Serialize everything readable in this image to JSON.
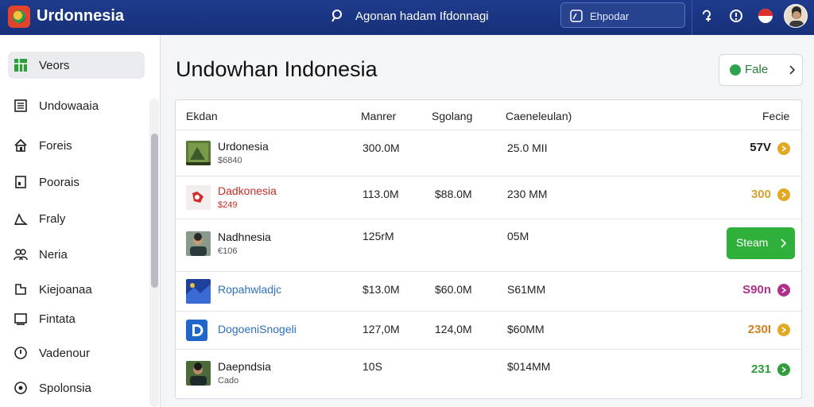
{
  "header": {
    "app_title": "Urdonnesia",
    "center_text": "Agonan hadam Ifdonnagi",
    "search_placeholder": "Ehpodar"
  },
  "sidebar": {
    "items": [
      {
        "label": "Veors",
        "icon": "grid-icon",
        "active": true
      },
      {
        "label": "Undowaaia",
        "icon": "document-icon",
        "active": false
      },
      {
        "label": "Foreis",
        "icon": "home-icon",
        "active": false
      },
      {
        "label": "Poorais",
        "icon": "page-icon",
        "active": false
      },
      {
        "label": "Fraly",
        "icon": "chart-icon",
        "active": false
      },
      {
        "label": "Neria",
        "icon": "people-icon",
        "active": false
      },
      {
        "label": "Kiejoanaa",
        "icon": "book-icon",
        "active": false
      },
      {
        "label": "Fintata",
        "icon": "folder-icon",
        "active": false
      },
      {
        "label": "Vadenour",
        "icon": "clock-icon",
        "active": false
      },
      {
        "label": "Spolonsia",
        "icon": "settings-icon",
        "active": false
      }
    ]
  },
  "main": {
    "title": "Undowhan Indonesia",
    "file_button_label": "Fale"
  },
  "table": {
    "columns": [
      "Ekdan",
      "Manrer",
      "Sgolang",
      "Caeneleulan)",
      "Fecie"
    ],
    "rows": [
      {
        "name": "Urdonesia",
        "sub": "$6840",
        "c1": "300.0M",
        "c2": "",
        "c3": "25.0 MII",
        "value": "57V",
        "name_color": "#1a1a1a",
        "value_color": "#1a1a1a",
        "dot_color": "#e3a923"
      },
      {
        "name": "Dadkonesia",
        "sub": "$249",
        "c1": "113.0M",
        "c2": "$88.0M",
        "c3": "230 MM",
        "value": "300",
        "name_color": "#c62d25",
        "value_color": "#d4a32a",
        "dot_color": "#e3a923"
      },
      {
        "name": "Nadhnesia",
        "sub": "€106",
        "c1": "125rM",
        "c2": "",
        "c3": "05M",
        "value": "",
        "button_label": "Steam",
        "name_color": "#1a1a1a",
        "value_color": "#1a1a1a",
        "dot_color": ""
      },
      {
        "name": "Ropahwladjc",
        "sub": "",
        "c1": "$13.0M",
        "c2": "$60.0M",
        "c3": "S61MM",
        "value": "S90n",
        "name_color": "#2a6fc0",
        "value_color": "#b0308e",
        "dot_color": "#b0308e"
      },
      {
        "name": "DogoeniSnogeli",
        "sub": "",
        "c1": "127,0M",
        "c2": "124,0M",
        "c3": "$60MM",
        "value": "230I",
        "name_color": "#2a6fc0",
        "value_color": "#d0821f",
        "dot_color": "#e3a923"
      },
      {
        "name": "Daepndsia",
        "sub": "Cado",
        "c1": "10S",
        "c2": "",
        "c3": "$014MM",
        "value": "231",
        "name_color": "#1a1a1a",
        "value_color": "#2e9e3a",
        "dot_color": "#2e9e3a"
      }
    ]
  }
}
